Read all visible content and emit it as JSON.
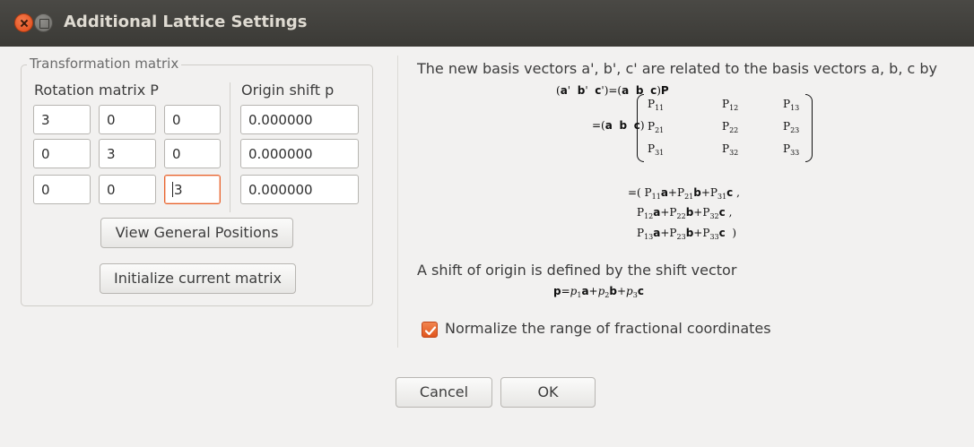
{
  "window": {
    "title": "Additional Lattice Settings"
  },
  "transform": {
    "group_label": "Transformation matrix",
    "rotation_label": "Rotation matrix P",
    "origin_label": "Origin shift p",
    "rotation": [
      [
        "3",
        "0",
        "0"
      ],
      [
        "0",
        "3",
        "0"
      ],
      [
        "0",
        "0",
        "3"
      ]
    ],
    "origin": [
      "0.000000",
      "0.000000",
      "0.000000"
    ],
    "view_button": "View General Positions",
    "init_button": "Initialize current matrix"
  },
  "info": {
    "line1": "The new basis vectors a', b', c' are related to the basis vectors a, b, c by",
    "shift_line": "A shift of origin is defined by the shift vector"
  },
  "options": {
    "normalize_label": "Normalize the range of fractional coordinates",
    "normalize_checked": true
  },
  "buttons": {
    "cancel": "Cancel",
    "ok": "OK"
  },
  "colors": {
    "accent": "#e8622c",
    "titlebar": "#3c3b37"
  }
}
